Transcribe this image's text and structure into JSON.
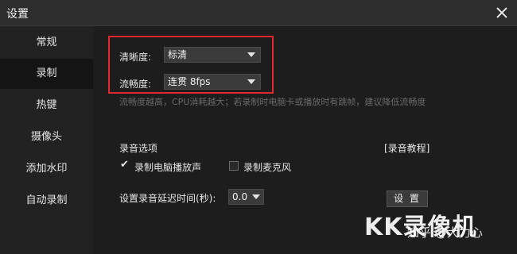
{
  "window": {
    "title": "设置"
  },
  "sidebar": {
    "items": [
      {
        "label": "常规"
      },
      {
        "label": "录制"
      },
      {
        "label": "热键"
      },
      {
        "label": "摄像头"
      },
      {
        "label": "添加水印"
      },
      {
        "label": "自动录制"
      }
    ],
    "active_index": 1
  },
  "recording": {
    "clarity_label": "清晰度:",
    "clarity_value": "标清",
    "fluency_label": "流畅度:",
    "fluency_value": "连贯 8fps",
    "hint": "流畅度越高，CPU消耗越大；若录制时电脑卡或播放时有跳帧，建议降低流畅度"
  },
  "audio": {
    "section_title": "录音选项",
    "tutorial_link": "[录音教程]",
    "record_pc_sound": {
      "label": "录制电脑播放声",
      "checked": true
    },
    "record_mic": {
      "label": "录制麦克风",
      "checked": false
    },
    "delay_label": "设置录音延迟时间(秒):",
    "delay_value": "0.0",
    "settings_button": "设 置"
  },
  "watermark": {
    "brand": "KK录像机",
    "overlay": "知乎 @大力心"
  },
  "colors": {
    "highlight_box": "#e0292f",
    "active_nav_bg": "#141414"
  }
}
